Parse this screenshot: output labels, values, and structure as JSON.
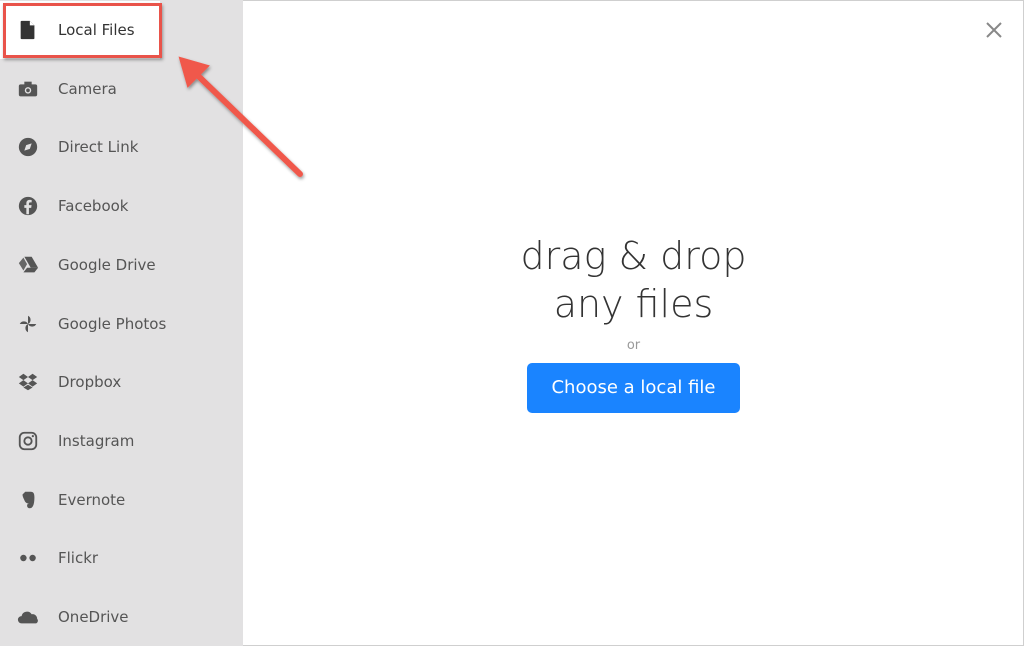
{
  "sidebar": {
    "items": [
      {
        "label": "Local Files",
        "icon": "file-icon",
        "active": true
      },
      {
        "label": "Camera",
        "icon": "camera-icon"
      },
      {
        "label": "Direct Link",
        "icon": "compass-icon"
      },
      {
        "label": "Facebook",
        "icon": "facebook-icon"
      },
      {
        "label": "Google Drive",
        "icon": "google-drive-icon"
      },
      {
        "label": "Google Photos",
        "icon": "google-photos-icon"
      },
      {
        "label": "Dropbox",
        "icon": "dropbox-icon"
      },
      {
        "label": "Instagram",
        "icon": "instagram-icon"
      },
      {
        "label": "Evernote",
        "icon": "evernote-icon"
      },
      {
        "label": "Flickr",
        "icon": "flickr-icon"
      },
      {
        "label": "OneDrive",
        "icon": "onedrive-icon"
      }
    ]
  },
  "main": {
    "title_line1": "drag & drop",
    "title_line2": "any files",
    "or": "or",
    "choose_button": "Choose a local file"
  },
  "colors": {
    "accent": "#1a84ff",
    "sidebar_bg": "#e2e1e2",
    "annotation": "#e9534a"
  }
}
